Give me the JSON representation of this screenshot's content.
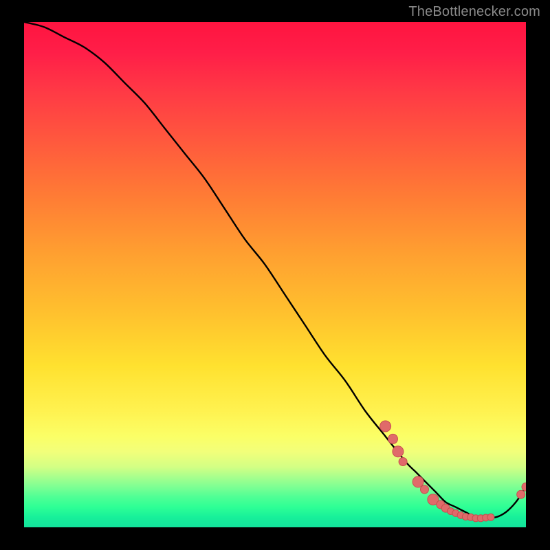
{
  "attribution": "TheBottlenecker.com",
  "colors": {
    "page_bg": "#000000",
    "attribution_text": "#8a8a8a",
    "curve": "#000000",
    "marker_fill": "#e06a6a",
    "marker_stroke": "#c84f4f"
  },
  "chart_data": {
    "type": "line",
    "title": "",
    "xlabel": "",
    "ylabel": "",
    "xlim": [
      0,
      100
    ],
    "ylim": [
      0,
      100
    ],
    "grid": false,
    "series": [
      {
        "name": "bottleneck-curve",
        "x": [
          0,
          4,
          8,
          12,
          16,
          20,
          24,
          28,
          32,
          36,
          40,
          44,
          48,
          52,
          56,
          60,
          64,
          68,
          72,
          76,
          78,
          80,
          82,
          84,
          86,
          88,
          90,
          92,
          94,
          96,
          98,
          100
        ],
        "y": [
          100,
          99,
          97,
          95,
          92,
          88,
          84,
          79,
          74,
          69,
          63,
          57,
          52,
          46,
          40,
          34,
          29,
          23,
          18,
          13,
          11,
          9,
          7,
          5,
          4,
          3,
          2,
          2,
          2,
          3,
          5,
          8
        ]
      }
    ],
    "markers": {
      "name": "highlight-points",
      "points": [
        {
          "x": 72.0,
          "y": 20.0,
          "r": 8
        },
        {
          "x": 73.5,
          "y": 17.5,
          "r": 7
        },
        {
          "x": 74.5,
          "y": 15.0,
          "r": 8
        },
        {
          "x": 75.5,
          "y": 13.0,
          "r": 6
        },
        {
          "x": 78.5,
          "y": 9.0,
          "r": 8
        },
        {
          "x": 79.8,
          "y": 7.5,
          "r": 6
        },
        {
          "x": 81.5,
          "y": 5.5,
          "r": 8
        },
        {
          "x": 83.0,
          "y": 4.5,
          "r": 6
        },
        {
          "x": 84.0,
          "y": 3.8,
          "r": 6
        },
        {
          "x": 85.0,
          "y": 3.2,
          "r": 5
        },
        {
          "x": 86.0,
          "y": 2.8,
          "r": 5
        },
        {
          "x": 87.0,
          "y": 2.4,
          "r": 5
        },
        {
          "x": 88.0,
          "y": 2.1,
          "r": 5
        },
        {
          "x": 89.0,
          "y": 2.0,
          "r": 5
        },
        {
          "x": 90.0,
          "y": 1.8,
          "r": 5
        },
        {
          "x": 91.0,
          "y": 1.8,
          "r": 5
        },
        {
          "x": 92.0,
          "y": 1.9,
          "r": 5
        },
        {
          "x": 93.0,
          "y": 2.0,
          "r": 5
        },
        {
          "x": 99.0,
          "y": 6.5,
          "r": 6
        },
        {
          "x": 100.0,
          "y": 8.0,
          "r": 6
        }
      ]
    },
    "background": "rainbow-gradient-vertical"
  }
}
